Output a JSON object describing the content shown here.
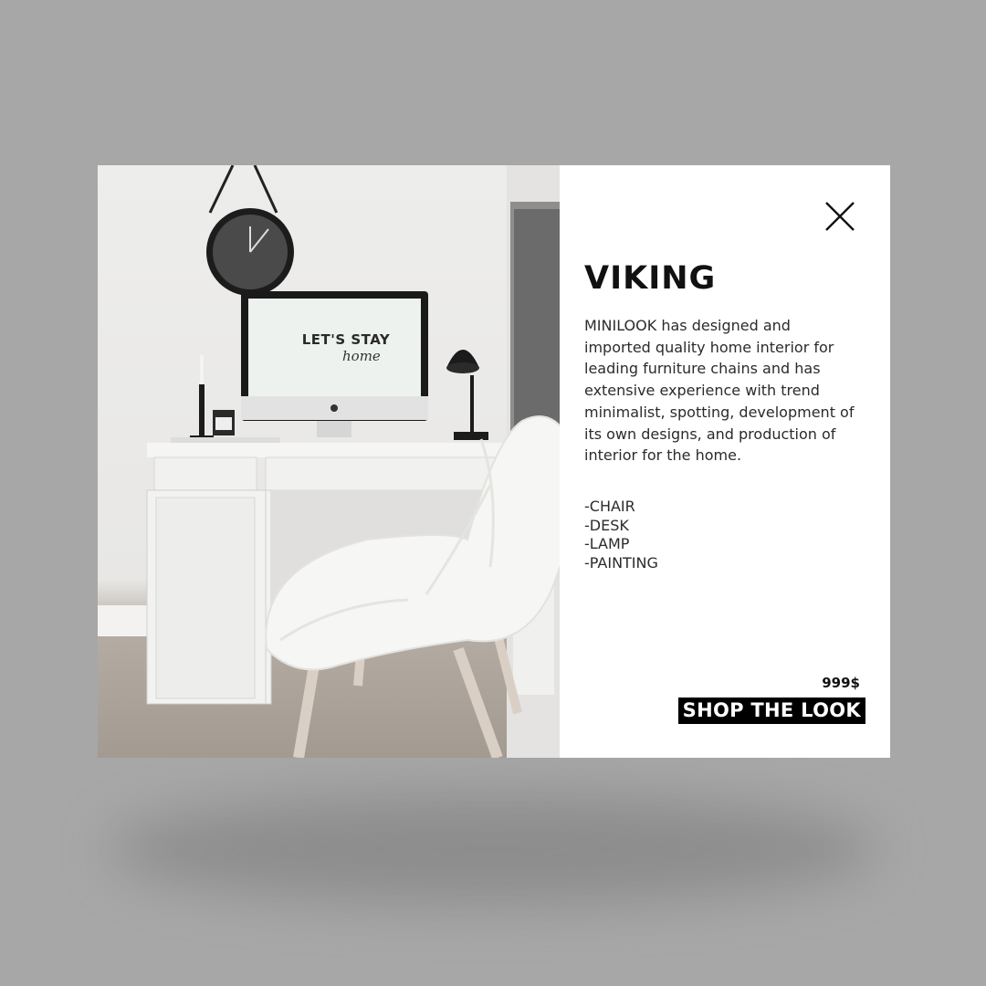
{
  "product": {
    "title": "VIKING",
    "description": "MINILOOK has designed and imported quality home interior for leading furniture chains and has extensive experience with trend minimalist, spotting, development of its own designs, and production of interior for the home.",
    "items": [
      "-CHAIR",
      "-DESK",
      "-LAMP",
      "-PAINTING"
    ],
    "price": "999$",
    "cta_label": "SHOP THE LOOK"
  },
  "photo": {
    "screen_text": "LET'S STAY",
    "screen_subtext": "home"
  },
  "icons": {
    "close": "close-icon"
  },
  "colors": {
    "backdrop": "#a7a7a7",
    "panel": "#ffffff",
    "cta_bg": "#000000",
    "cta_text": "#ffffff"
  }
}
